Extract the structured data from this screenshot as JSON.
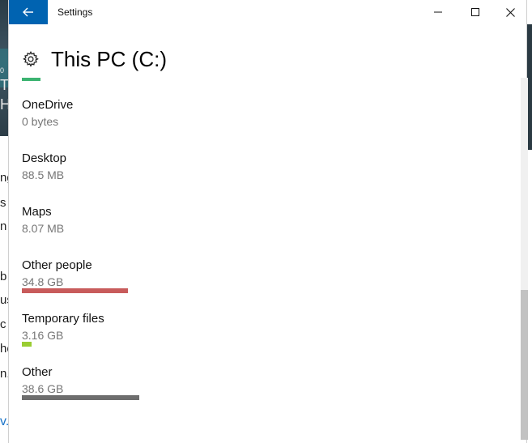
{
  "window": {
    "title": "Settings",
    "back_icon": "back-arrow-icon",
    "minimize_icon": "minimize-icon",
    "maximize_icon": "maximize-icon",
    "close_icon": "close-icon",
    "accent_color": "#0063b1"
  },
  "header": {
    "icon": "gear-icon",
    "title": "This PC (C:)",
    "usage_color": "#3cb371"
  },
  "items": [
    {
      "name": "OneDrive",
      "size": "0 bytes",
      "bar_color": "",
      "bar_fraction": 0
    },
    {
      "name": "Desktop",
      "size": "88.5 MB",
      "bar_color": "",
      "bar_fraction": 0
    },
    {
      "name": "Maps",
      "size": "8.07 MB",
      "bar_color": "",
      "bar_fraction": 0
    },
    {
      "name": "Other people",
      "size": "34.8 GB",
      "bar_color": "#c85b5b",
      "bar_fraction": 0.902
    },
    {
      "name": "Temporary files",
      "size": "3.16 GB",
      "bar_color": "#9acd32",
      "bar_fraction": 0.082
    },
    {
      "name": "Other",
      "size": "38.6 GB",
      "bar_color": "#6e6e6e",
      "bar_fraction": 1.0
    }
  ],
  "background": {
    "fragments": [
      "0",
      "T",
      "H",
      "ng",
      "s",
      "n",
      "b",
      "us",
      "c",
      "he",
      "n.",
      "v."
    ]
  }
}
